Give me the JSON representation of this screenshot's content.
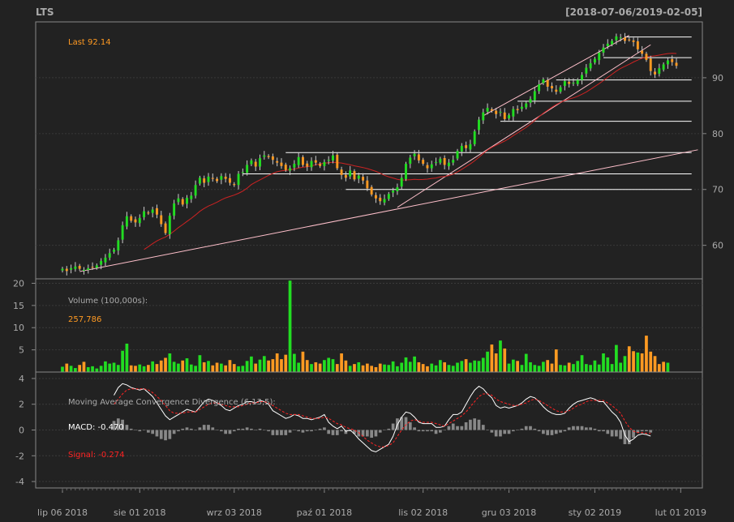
{
  "header": {
    "symbol": "LTS",
    "date_range": "[2018-07-06/2019-02-05]"
  },
  "colors": {
    "background": "#222222",
    "panel_border": "#888888",
    "grid": "#3a3a3a",
    "up": "#22dd22",
    "down": "#ff9a22",
    "text": "#aaaaaa",
    "highlight": "#ff9a22",
    "signal": "#ff2222",
    "macd_line": "#ffffff",
    "ma": "#cc2222",
    "trendline": "#ffc0cb",
    "hline": "#ffffff"
  },
  "chart_data": [
    {
      "type": "candlestick",
      "panel": "price",
      "annotation_label": "Last 92.14",
      "last": 92.14,
      "ylim": [
        54,
        100
      ],
      "yticks": [
        60,
        70,
        80,
        90
      ],
      "ytick_labels": [
        "60",
        "70",
        "80",
        "90"
      ],
      "x_dates": [
        "lip 06 2018",
        "sie 01 2018",
        "wrz 03 2018",
        "paź 01 2018",
        "lis 02 2018",
        "gru 03 2018",
        "sty 02 2019",
        "lut 01 2019"
      ],
      "x_date_index": [
        0,
        18,
        40,
        61,
        84,
        104,
        124,
        144
      ],
      "close": [
        55.8,
        55.4,
        55.9,
        56.2,
        55.8,
        55.6,
        55.9,
        56.1,
        56.4,
        57.2,
        57.8,
        58.6,
        59.2,
        60.9,
        63.6,
        65.2,
        64.4,
        64.1,
        64.9,
        66.1,
        65.8,
        66.4,
        65.5,
        63.8,
        62.2,
        65.3,
        67.5,
        68.4,
        67.3,
        68.5,
        68.9,
        70.8,
        72.1,
        71.2,
        72.3,
        71.9,
        71.5,
        72.4,
        71.9,
        71.2,
        70.8,
        72.8,
        73.1,
        74.4,
        75.2,
        74.1,
        75.6,
        76.1,
        75.8,
        75.3,
        74.8,
        74.2,
        73.5,
        73.8,
        74.6,
        75.8,
        74.4,
        74.1,
        75.1,
        74.8,
        74.2,
        74.9,
        75.3,
        76.1,
        73.8,
        72.6,
        72.1,
        73.4,
        71.8,
        72.5,
        71.6,
        70.2,
        69.1,
        68.4,
        67.9,
        68.3,
        69.2,
        69.8,
        70.4,
        72.1,
        74.6,
        75.7,
        76.4,
        75.2,
        74.6,
        73.8,
        74.5,
        74.9,
        75.5,
        74.4,
        74.8,
        75.3,
        76.9,
        77.8,
        77.4,
        78.1,
        80.4,
        82.5,
        83.8,
        84.6,
        84.1,
        83.5,
        83.9,
        82.6,
        83.3,
        84.4,
        84.2,
        84.8,
        85.4,
        86.2,
        87.6,
        88.8,
        89.7,
        88.4,
        88.1,
        87.5,
        88.3,
        89.4,
        88.9,
        89.1,
        89.6,
        90.5,
        91.8,
        92.6,
        93.4,
        94.5,
        95.4,
        96.1,
        96.6,
        97.4,
        97.2,
        96.6,
        96.8,
        96.4,
        95.1,
        94.3,
        93.2,
        91.2,
        90.6,
        91.7,
        92.4,
        93.1,
        92.8,
        92.14
      ],
      "moving_average": {
        "window": 20
      },
      "hlines": [
        {
          "y": 70.0,
          "x_from": 66,
          "x_to": 142
        },
        {
          "y": 72.8,
          "x_from": 42,
          "x_to": 142
        },
        {
          "y": 76.6,
          "x_from": 52,
          "x_to": 142
        },
        {
          "y": 82.2,
          "x_from": 102,
          "x_to": 142
        },
        {
          "y": 85.8,
          "x_from": 106,
          "x_to": 142
        },
        {
          "y": 89.6,
          "x_from": 115,
          "x_to": 142
        },
        {
          "y": 93.6,
          "x_from": 126,
          "x_to": 142
        },
        {
          "y": 97.3,
          "x_from": 131,
          "x_to": 142
        }
      ],
      "trendlines": [
        {
          "x1": 4,
          "y1": 55.3,
          "x2": 148,
          "y2": 77.1
        },
        {
          "x1": 78,
          "y1": 66.8,
          "x2": 137,
          "y2": 95.9
        },
        {
          "x1": 98,
          "y1": 83.2,
          "x2": 132,
          "y2": 97.6
        }
      ]
    },
    {
      "type": "bar",
      "panel": "volume",
      "title": "Volume (100,000s):",
      "annotation_label": "257,786",
      "ylim": [
        0,
        21
      ],
      "yticks": [
        5,
        10,
        15,
        20
      ],
      "ytick_labels": [
        "5",
        "10",
        "15",
        "20"
      ],
      "values": [
        1.2,
        1.9,
        1.4,
        0.9,
        1.6,
        2.3,
        1.1,
        1.3,
        0.8,
        1.4,
        2.4,
        1.9,
        2.1,
        1.6,
        4.8,
        6.4,
        1.5,
        1.4,
        1.7,
        1.3,
        1.6,
        2.4,
        1.8,
        2.6,
        3.2,
        4.2,
        2.3,
        1.9,
        2.6,
        3.1,
        1.7,
        1.4,
        3.8,
        2.2,
        2.5,
        1.5,
        2.1,
        1.9,
        1.5,
        2.7,
        1.8,
        1.3,
        1.4,
        2.5,
        3.5,
        1.9,
        2.8,
        3.6,
        2.6,
        2.9,
        4.2,
        2.9,
        3.9,
        20.6,
        4.1,
        2.1,
        4.6,
        2.7,
        1.8,
        2.2,
        1.9,
        2.7,
        3.2,
        2.9,
        1.8,
        4.2,
        2.6,
        1.4,
        1.8,
        2.2,
        1.5,
        1.9,
        1.4,
        1.1,
        1.9,
        1.7,
        1.6,
        2.4,
        1.3,
        2.1,
        3.3,
        2.3,
        3.5,
        2.2,
        1.8,
        1.3,
        1.9,
        1.5,
        2.7,
        2.2,
        1.6,
        1.4,
        2.1,
        2.5,
        2.9,
        2.1,
        2.6,
        2.5,
        3.2,
        4.6,
        6.2,
        4.2,
        7.1,
        5.3,
        1.9,
        2.8,
        2.5,
        1.6,
        4.1,
        2.2,
        1.6,
        1.4,
        2.3,
        2.7,
        1.9,
        5.1,
        1.6,
        1.5,
        2.1,
        1.8,
        2.5,
        3.8,
        1.8,
        1.6,
        2.6,
        1.7,
        4.2,
        3.3,
        1.8,
        6.1,
        2.1,
        3.6,
        5.8,
        4.7,
        4.4,
        4.2,
        8.2,
        4.6,
        3.6,
        1.8,
        2.3,
        2.1
      ],
      "up_flags": [
        1,
        0,
        1,
        1,
        0,
        0,
        1,
        1,
        1,
        1,
        1,
        1,
        1,
        1,
        1,
        1,
        0,
        0,
        1,
        1,
        0,
        1,
        0,
        0,
        0,
        1,
        1,
        1,
        0,
        1,
        1,
        1,
        1,
        0,
        1,
        0,
        0,
        1,
        0,
        0,
        0,
        1,
        1,
        1,
        1,
        0,
        1,
        1,
        0,
        0,
        0,
        0,
        0,
        1,
        1,
        1,
        0,
        0,
        1,
        0,
        0,
        1,
        1,
        1,
        0,
        0,
        0,
        1,
        0,
        1,
        0,
        0,
        0,
        0,
        0,
        1,
        1,
        1,
        1,
        1,
        1,
        1,
        1,
        0,
        0,
        0,
        1,
        1,
        1,
        0,
        1,
        1,
        1,
        1,
        0,
        1,
        1,
        1,
        1,
        1,
        0,
        0,
        1,
        0,
        1,
        1,
        0,
        1,
        1,
        1,
        1,
        1,
        1,
        0,
        0,
        0,
        1,
        1,
        0,
        1,
        1,
        1,
        1,
        1,
        1,
        1,
        1,
        1,
        1,
        1,
        1,
        1,
        0,
        0,
        1,
        0,
        0,
        0,
        0,
        0,
        0,
        1,
        1,
        1,
        0,
        0
      ]
    },
    {
      "type": "macd",
      "panel": "macd",
      "title": "Moving Average Convergence Divergence (6,13,5):",
      "macd_label": "MACD: -0.470",
      "signal_label": "Signal: -0.274",
      "macd_last": -0.47,
      "signal_last": -0.274,
      "ylim": [
        -4.5,
        4.5
      ],
      "yticks": [
        -4,
        -2,
        0,
        2,
        4
      ],
      "ytick_labels": [
        "-4",
        "-2",
        "0",
        "2",
        "4"
      ],
      "start_index": 12,
      "macd": [
        2.7,
        3.3,
        3.6,
        3.5,
        3.3,
        3.2,
        3.1,
        3.2,
        2.9,
        2.6,
        2.1,
        1.6,
        1.1,
        0.8,
        1.0,
        1.2,
        1.4,
        1.6,
        1.5,
        1.4,
        1.8,
        2.2,
        2.4,
        2.3,
        2.1,
        1.9,
        1.6,
        1.5,
        1.7,
        1.9,
        2.0,
        2.2,
        2.2,
        2.1,
        2.3,
        2.2,
        2.0,
        1.5,
        1.3,
        1.1,
        0.9,
        1.0,
        1.2,
        1.1,
        0.9,
        0.9,
        0.8,
        0.9,
        1.0,
        1.2,
        0.6,
        0.3,
        0.1,
        0.3,
        -0.1,
        0.0,
        -0.3,
        -0.7,
        -1.0,
        -1.3,
        -1.6,
        -1.7,
        -1.5,
        -1.3,
        -1.1,
        -0.5,
        0.4,
        1.0,
        1.4,
        1.3,
        1.0,
        0.6,
        0.5,
        0.5,
        0.5,
        0.2,
        0.2,
        0.3,
        0.8,
        1.2,
        1.2,
        1.4,
        2.0,
        2.6,
        3.1,
        3.4,
        3.2,
        2.8,
        2.5,
        1.9,
        1.7,
        1.8,
        1.7,
        1.8,
        1.9,
        2.1,
        2.4,
        2.6,
        2.5,
        2.2,
        1.8,
        1.5,
        1.3,
        1.2,
        1.2,
        1.3,
        1.7,
        2.0,
        2.2,
        2.3,
        2.4,
        2.5,
        2.4,
        2.2,
        2.2,
        1.8,
        1.4,
        1.1,
        0.6,
        -0.4,
        -0.9,
        -0.7,
        -0.4,
        -0.3,
        -0.35,
        -0.47
      ],
      "signal": [
        2.0,
        2.4,
        2.8,
        3.1,
        3.2,
        3.2,
        3.2,
        3.2,
        3.1,
        2.9,
        2.6,
        2.3,
        1.9,
        1.5,
        1.3,
        1.3,
        1.3,
        1.4,
        1.4,
        1.4,
        1.6,
        1.8,
        2.0,
        2.1,
        2.1,
        2.0,
        1.9,
        1.8,
        1.8,
        1.8,
        1.9,
        2.0,
        2.1,
        2.1,
        2.2,
        2.2,
        2.1,
        1.9,
        1.7,
        1.5,
        1.3,
        1.2,
        1.2,
        1.2,
        1.1,
        1.0,
        0.9,
        0.9,
        0.9,
        1.0,
        0.9,
        0.7,
        0.5,
        0.4,
        0.2,
        0.1,
        0.0,
        -0.2,
        -0.5,
        -0.8,
        -1.0,
        -1.2,
        -1.3,
        -1.3,
        -1.2,
        -1.0,
        -0.5,
        0.0,
        0.4,
        0.7,
        0.8,
        0.7,
        0.6,
        0.6,
        0.6,
        0.5,
        0.4,
        0.3,
        0.5,
        0.7,
        0.9,
        1.1,
        1.4,
        1.8,
        2.2,
        2.6,
        2.8,
        2.8,
        2.7,
        2.4,
        2.2,
        2.1,
        2.0,
        1.9,
        1.9,
        2.0,
        2.1,
        2.3,
        2.4,
        2.3,
        2.1,
        1.9,
        1.7,
        1.5,
        1.4,
        1.4,
        1.5,
        1.7,
        1.9,
        2.0,
        2.2,
        2.3,
        2.3,
        2.3,
        2.3,
        2.1,
        1.9,
        1.6,
        1.3,
        0.7,
        0.2,
        -0.1,
        -0.2,
        -0.2,
        -0.25,
        -0.274
      ]
    }
  ]
}
